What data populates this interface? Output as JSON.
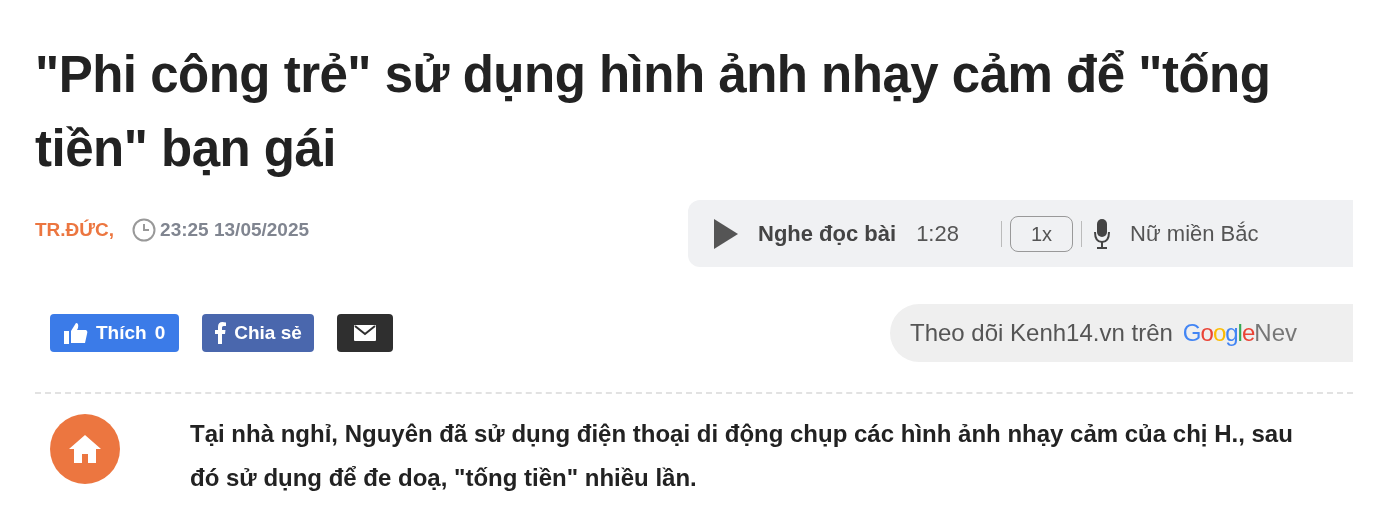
{
  "title": "\"Phi công trẻ\" sử dụng hình ảnh nhạy cảm để \"tống tiền\" bạn gái",
  "meta": {
    "author": "TR.ĐỨC,",
    "time": "23:25 13/05/2025"
  },
  "audio_player": {
    "label": "Nghe đọc bài",
    "duration": "1:28",
    "speed": "1x",
    "voice": "Nữ miền Bắc"
  },
  "share_buttons": [
    {
      "kind": "like",
      "label": "Thích",
      "count": "0"
    },
    {
      "kind": "share",
      "label": "Chia sẻ"
    },
    {
      "kind": "email"
    }
  ],
  "follow": {
    "text": "Theo dõi Kenh14.vn trên",
    "brand": "Google",
    "suffix": "Nev"
  },
  "summary": "Tại nhà nghỉ, Nguyên đã sử dụng điện thoại di động chụp các hình ảnh nhạy cảm của chị H., sau đó sử dụng để đe doạ, \"tống tiền\" nhiều lần."
}
